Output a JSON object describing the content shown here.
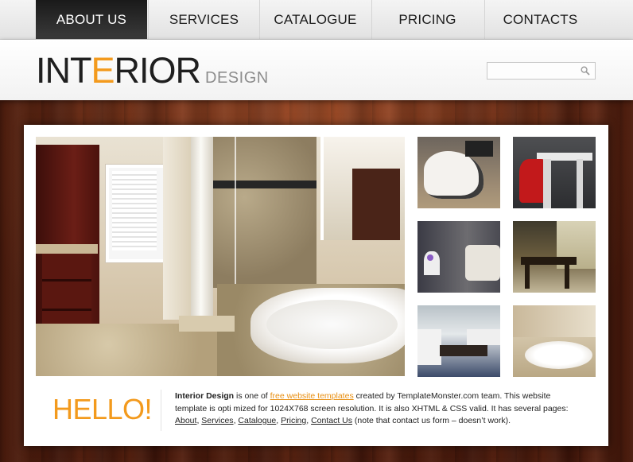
{
  "nav": {
    "items": [
      {
        "label": "ABOUT US",
        "active": true
      },
      {
        "label": "SERVICES",
        "active": false
      },
      {
        "label": "CATALOGUE",
        "active": false
      },
      {
        "label": "PRICING",
        "active": false
      },
      {
        "label": "CONTACTS",
        "active": false
      }
    ]
  },
  "header": {
    "logo_part1": "INT",
    "logo_accent": "E",
    "logo_part2": "RIOR",
    "logo_sub": "DESIGN",
    "search_value": "",
    "search_icon": "search-icon"
  },
  "colors": {
    "accent": "#f39a1d",
    "nav_active_bg": "#1a1a1a",
    "wood": "#6a2612"
  },
  "gallery": {
    "main_image": "bathroom-photo",
    "thumbnails": [
      "white-lounge-chair",
      "red-chair-table",
      "bedroom-lamp",
      "veranda-chairs",
      "living-room-table",
      "bathtub-thumb"
    ]
  },
  "intro": {
    "hello": "HELLO!",
    "brand": "Interior Design",
    "text1": " is one of ",
    "link_templates": "free website templates",
    "text2": " created by TemplateMonster.com team. This website template is opti mized for 1024X768 screen resolution. It is also XHTML & CSS valid. It has several pages: ",
    "link_about": "About",
    "sep1": ", ",
    "link_services": "Services",
    "sep2": ", ",
    "link_catalogue": "Catalogue",
    "sep3": ", ",
    "link_pricing": "Pricing",
    "sep4": ", ",
    "link_contact": "Contact Us",
    "text3": " (note that contact us form – doesn’t work)."
  }
}
